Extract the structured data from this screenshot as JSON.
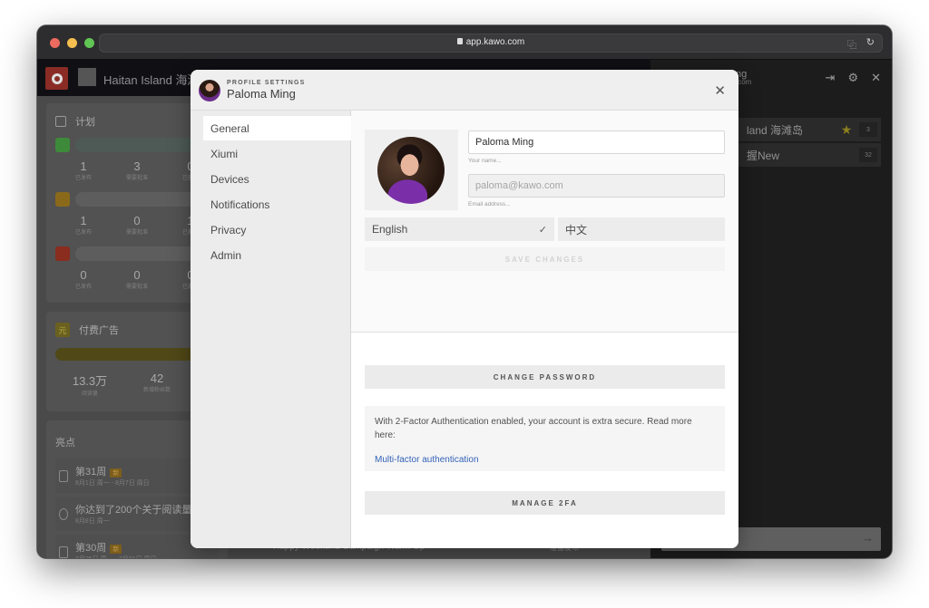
{
  "browser": {
    "url": "app.kawo.com",
    "icons": [
      "lock-icon",
      "translate-icon",
      "reload-icon"
    ]
  },
  "background_app": {
    "team_name": "Haitan Island 海滩岛",
    "plan_card": {
      "title": "计划",
      "platforms": [
        {
          "name": "wechat",
          "color": "#3d8a3a",
          "stats": [
            {
              "n": "1",
              "l": "已发布"
            },
            {
              "n": "3",
              "l": "需要批准"
            },
            {
              "n": "0",
              "l": "已批准"
            }
          ]
        },
        {
          "name": "weibo",
          "color": "#8a6a1a",
          "stats": [
            {
              "n": "1",
              "l": "已发布"
            },
            {
              "n": "0",
              "l": "需要批准"
            },
            {
              "n": "1",
              "l": "已批准"
            }
          ]
        },
        {
          "name": "douyin",
          "color": "#8a2c1e",
          "stats": [
            {
              "n": "0",
              "l": "已发布"
            },
            {
              "n": "0",
              "l": "需要批准"
            },
            {
              "n": "0",
              "l": "已批准"
            }
          ]
        }
      ]
    },
    "ads_card": {
      "icon_text": "元",
      "title": "付费广告",
      "stats": [
        {
          "n": "13.3万",
          "l": "阅读量"
        },
        {
          "n": "42",
          "l": "新增粉丝数"
        }
      ]
    },
    "highlights": {
      "title": "亮点",
      "items": [
        {
          "title": "第31周",
          "badge": "新",
          "sub": "8月1日 周一 - 8月7日 周日"
        },
        {
          "title": "你达到了200个关于阅读量",
          "badge": "",
          "sub": "8月8日 周一"
        },
        {
          "title": "第30周",
          "badge": "新",
          "sub": "7月25日 周一 - 7月31日 周日"
        }
      ]
    },
    "bottom_peek": "Happy Weekend Campaign Warm-Up",
    "bottom_peek_right": "准备发布",
    "right_panel": {
      "user_name_partial": "ng",
      "user_email_partial": ".com",
      "teams": [
        {
          "name": "land 海滩岛",
          "starred": true,
          "count": "3"
        },
        {
          "name": "握New",
          "starred": false,
          "count": "32"
        }
      ],
      "action_icons": [
        "logout-icon",
        "gear-icon",
        "close-icon"
      ]
    }
  },
  "modal": {
    "kicker": "PROFILE SETTINGS",
    "title": "Paloma Ming",
    "nav": [
      {
        "label": "General",
        "active": true
      },
      {
        "label": "Xiumi",
        "active": false
      },
      {
        "label": "Devices",
        "active": false
      },
      {
        "label": "Notifications",
        "active": false
      },
      {
        "label": "Privacy",
        "active": false
      },
      {
        "label": "Admin",
        "active": false
      }
    ],
    "general": {
      "name_value": "Paloma Ming",
      "name_hint": "Your name...",
      "email_value": "paloma@kawo.com",
      "email_hint": "Email address...",
      "languages": [
        {
          "label": "English",
          "selected": true
        },
        {
          "label": "中文",
          "selected": false
        }
      ],
      "save_label": "SAVE CHANGES",
      "change_password_label": "CHANGE PASSWORD",
      "tfa_text": "With 2-Factor Authentication enabled, your account is extra secure. Read more here:",
      "tfa_link": "Multi-factor authentication",
      "manage_2fa_label": "MANAGE 2FA"
    }
  }
}
